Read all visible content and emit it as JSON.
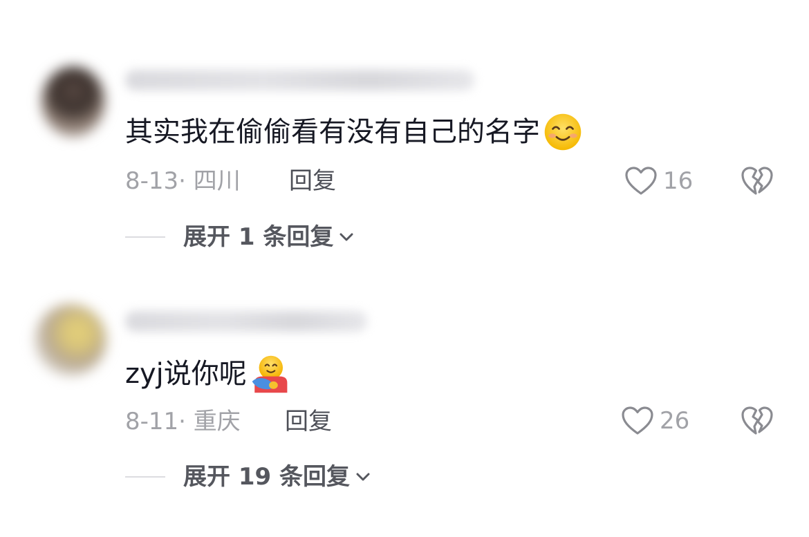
{
  "comments": [
    {
      "text": "其实我在偷偷看有没有自己的名字",
      "emoji": "smiling-face-emoji",
      "date": "8-13",
      "location": "四川",
      "reply_label": "回复",
      "likes": "16",
      "expand_label": "展开 1 条回复"
    },
    {
      "text": "zyj说你呢",
      "emoji": "hugging-face-emoji",
      "date": "8-11",
      "location": "重庆",
      "reply_label": "回复",
      "likes": "26",
      "expand_label": "展开 19 条回复"
    }
  ]
}
